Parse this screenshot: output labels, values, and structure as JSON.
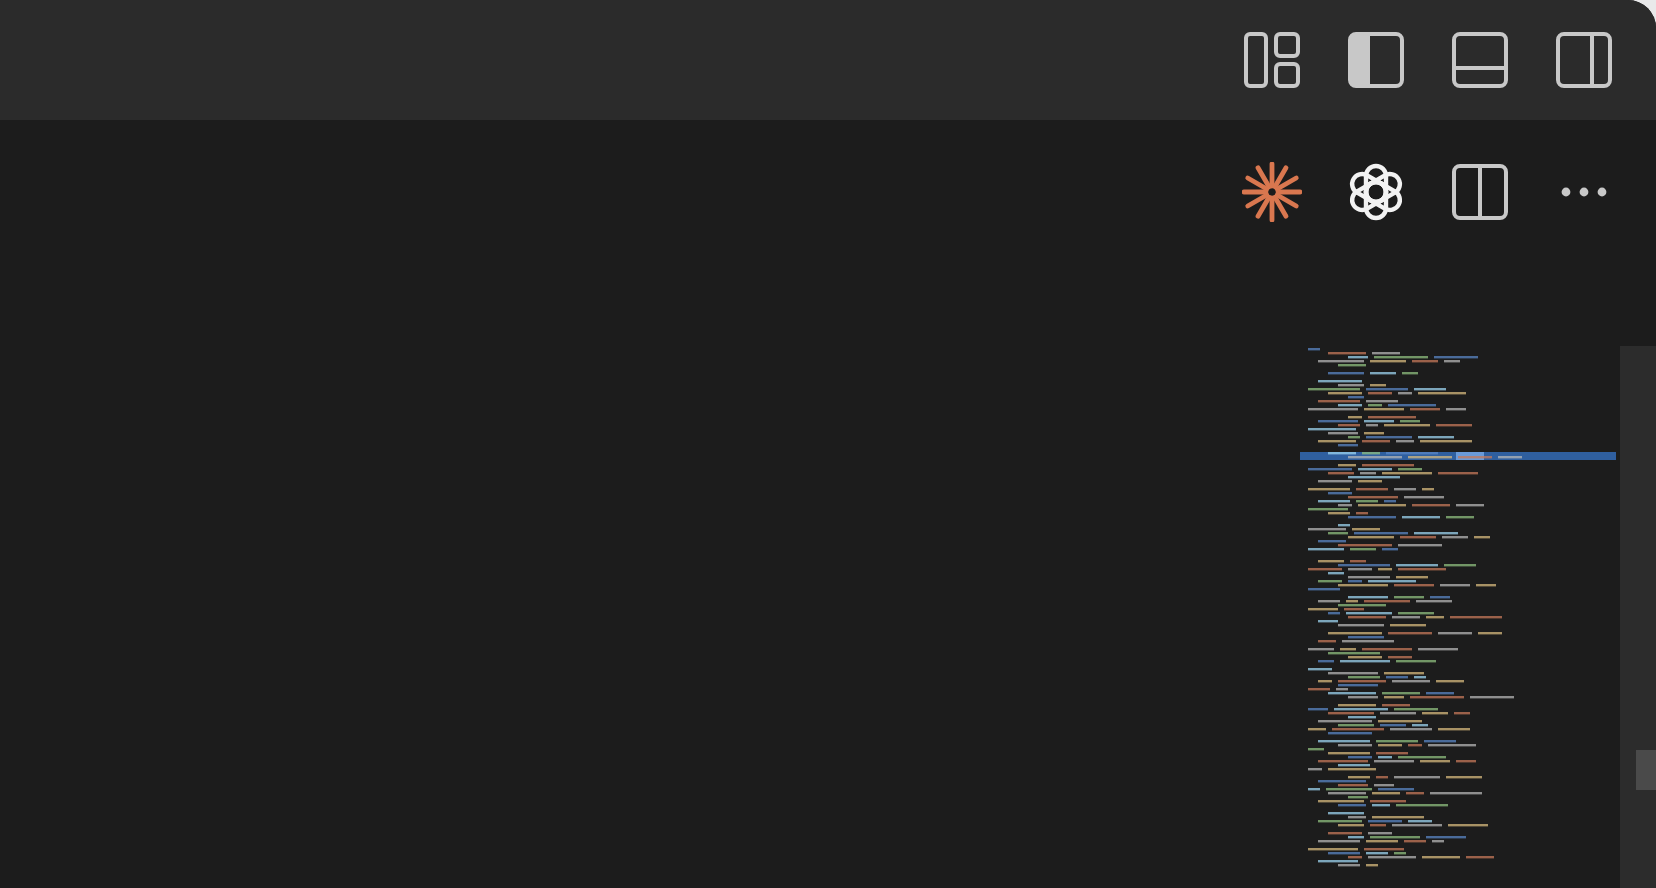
{
  "layout_controls": [
    {
      "kind": "customize",
      "on": false
    },
    {
      "kind": "primary_sidebar",
      "on": true
    },
    {
      "kind": "panel",
      "on": false
    },
    {
      "kind": "secondary_sidebar",
      "on": false
    }
  ],
  "editor_actions": [
    {
      "kind": "asterisk"
    },
    {
      "kind": "knot"
    },
    {
      "kind": "split"
    },
    {
      "kind": "more"
    }
  ]
}
